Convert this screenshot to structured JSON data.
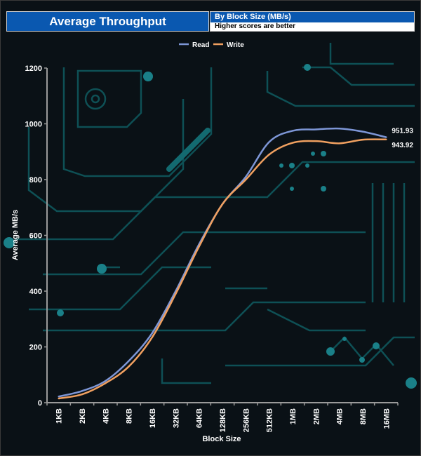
{
  "header": {
    "title": "Average Throughput",
    "subtitle": "By Block Size (MB/s)",
    "note": "Higher scores are better"
  },
  "chart_data": {
    "type": "line",
    "title": "Average Throughput",
    "subtitle": "By Block Size (MB/s)",
    "xlabel": "Block Size",
    "ylabel": "Average MB/s",
    "ylim": [
      0,
      1200
    ],
    "yticks": [
      0,
      200,
      400,
      600,
      800,
      1000,
      1200
    ],
    "grid": false,
    "legend_position": "top-center",
    "categories": [
      "1KB",
      "2KB",
      "4KB",
      "8KB",
      "16KB",
      "32KB",
      "64KB",
      "128KB",
      "256KB",
      "512KB",
      "1MB",
      "2MB",
      "4MB",
      "8MB",
      "16MB"
    ],
    "series": [
      {
        "name": "Read",
        "color": "#7d96d6",
        "values": [
          22,
          42,
          78,
          150,
          250,
          400,
          568,
          712,
          810,
          935,
          975,
          980,
          983,
          972,
          951.93
        ],
        "end_label": "951.93"
      },
      {
        "name": "Write",
        "color": "#f0a060",
        "values": [
          15,
          30,
          70,
          130,
          235,
          390,
          560,
          712,
          800,
          890,
          932,
          938,
          930,
          943,
          943.92
        ],
        "end_label": "943.92"
      }
    ]
  }
}
